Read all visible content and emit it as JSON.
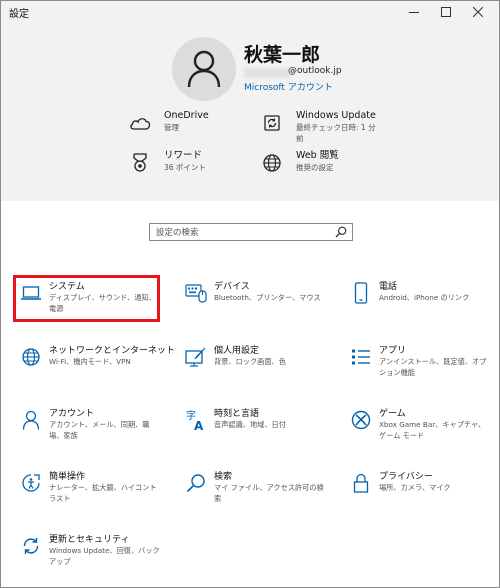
{
  "window": {
    "title": "設定"
  },
  "user": {
    "name": "秋葉一郎",
    "email_suffix": "@outlook.jp",
    "account_link": "Microsoft アカウント"
  },
  "quick_links": [
    {
      "title": "OneDrive",
      "subtitle": "管理",
      "icon": "cloud-icon"
    },
    {
      "title": "Windows Update",
      "subtitle": "最終チェック日時: 1 分前",
      "icon": "sync-icon"
    },
    {
      "title": "リワード",
      "subtitle": "36 ポイント",
      "icon": "medal-icon"
    },
    {
      "title": "Web 閲覧",
      "subtitle": "推奨の設定",
      "icon": "globe-icon"
    }
  ],
  "search": {
    "placeholder": "設定の検索"
  },
  "categories": [
    {
      "title": "システム",
      "desc": "ディスプレイ、サウンド、通知、電源",
      "icon": "laptop-icon"
    },
    {
      "title": "デバイス",
      "desc": "Bluetooth、プリンター、マウス",
      "icon": "keyboard-icon"
    },
    {
      "title": "電話",
      "desc": "Android、iPhone のリンク",
      "icon": "phone-icon"
    },
    {
      "title": "ネットワークとインターネット",
      "desc": "Wi-Fi、機内モード、VPN",
      "icon": "globe-icon"
    },
    {
      "title": "個人用設定",
      "desc": "背景、ロック画面、色",
      "icon": "paint-icon"
    },
    {
      "title": "アプリ",
      "desc": "アンインストール、既定値、オプション機能",
      "icon": "apps-list-icon"
    },
    {
      "title": "アカウント",
      "desc": "アカウント、メール、同期、職場、家族",
      "icon": "person-icon"
    },
    {
      "title": "時刻と言語",
      "desc": "音声認識、地域、日付",
      "icon": "language-icon"
    },
    {
      "title": "ゲーム",
      "desc": "Xbox Game Bar、キャプチャ、ゲーム モード",
      "icon": "xbox-icon"
    },
    {
      "title": "簡単操作",
      "desc": "ナレーター、拡大鏡、ハイコントラスト",
      "icon": "accessibility-icon"
    },
    {
      "title": "検索",
      "desc": "マイ ファイル、アクセス許可の検索",
      "icon": "search-icon"
    },
    {
      "title": "プライバシー",
      "desc": "場所、カメラ、マイク",
      "icon": "lock-icon"
    },
    {
      "title": "更新とセキュリティ",
      "desc": "Windows Update、回復、バックアップ",
      "icon": "update-icon"
    }
  ],
  "colors": {
    "accent": "#0063b1",
    "highlight": "#e8141c",
    "header_bg": "#f2f2f2"
  }
}
